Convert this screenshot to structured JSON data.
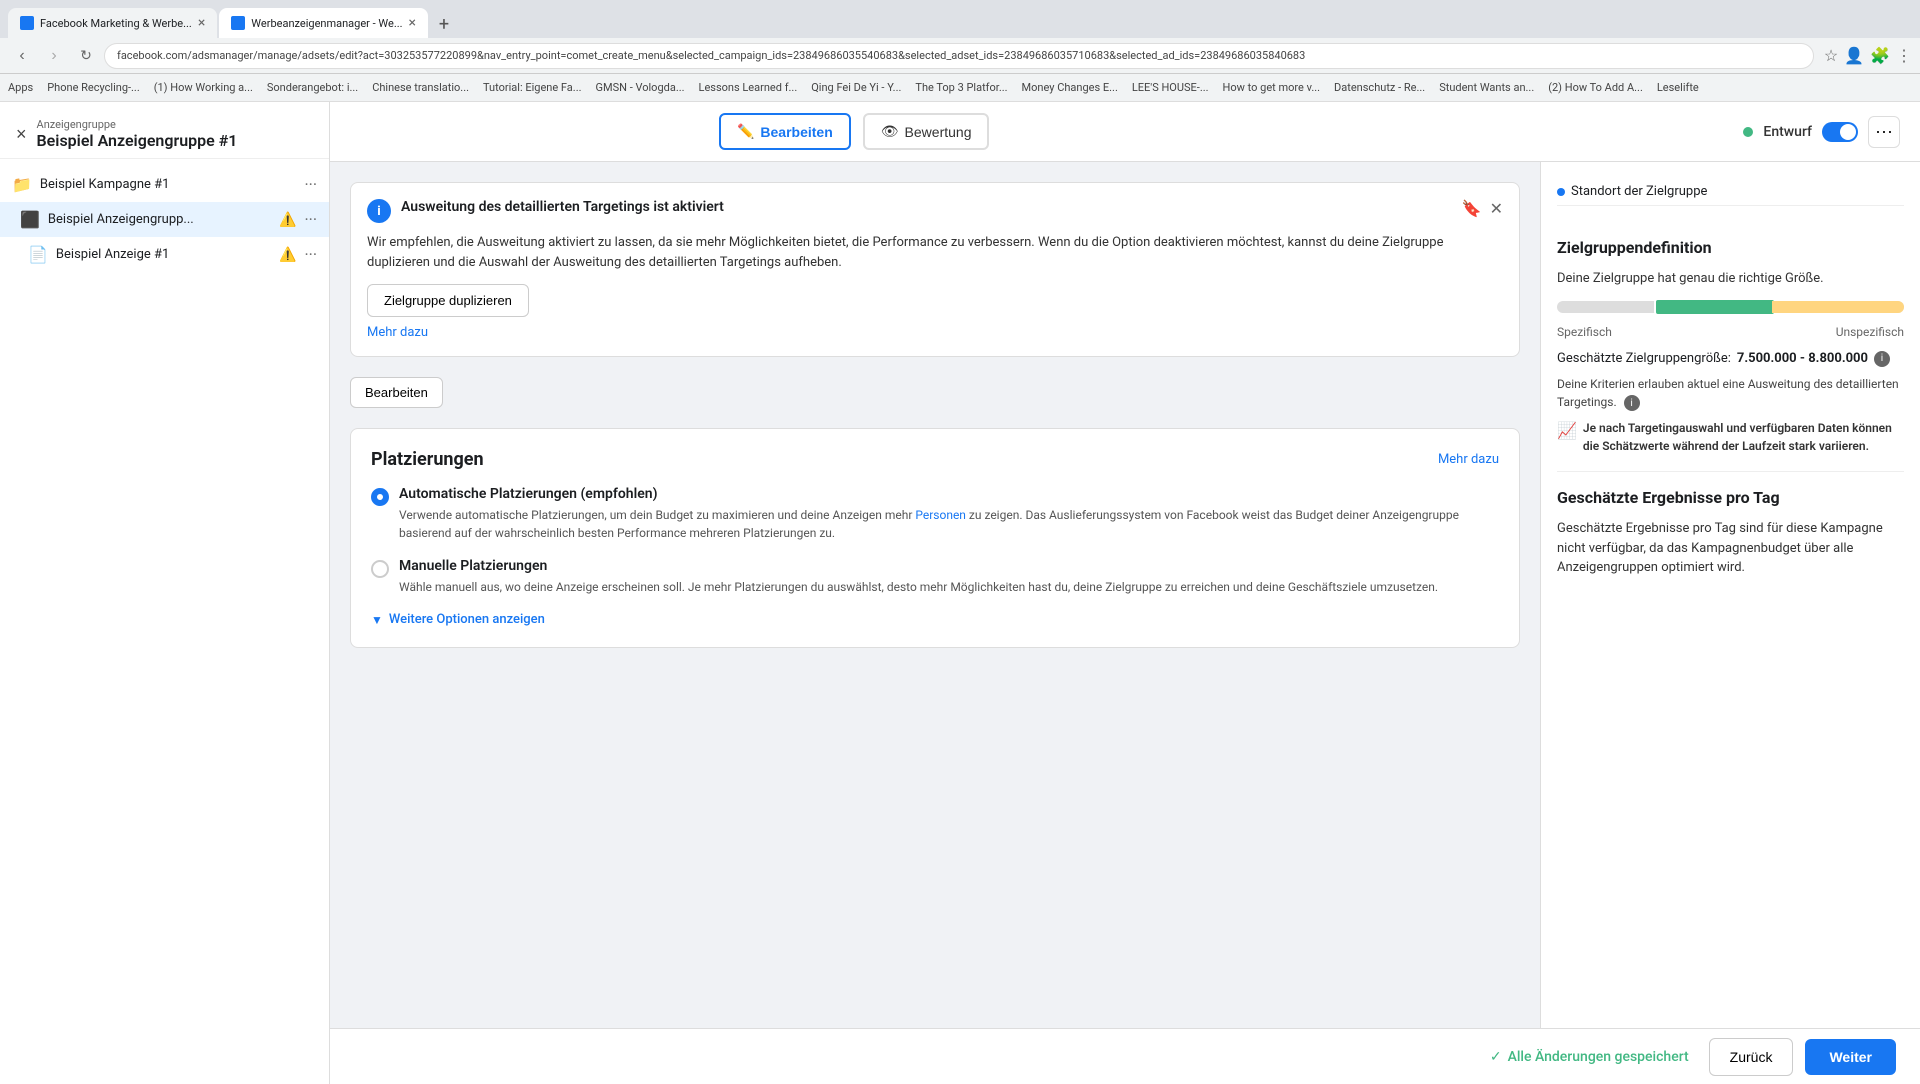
{
  "browser": {
    "tabs": [
      {
        "id": "tab1",
        "title": "Facebook Marketing & Werbe...",
        "active": false
      },
      {
        "id": "tab2",
        "title": "Werbeanzeigenmanager - We...",
        "active": true
      }
    ],
    "url": "facebook.com/adsmanager/manage/adsets/edit?act=303253577220899&nav_entry_point=comet_create_menu&selected_campaign_ids=23849686035540683&selected_adset_ids=23849686035710683&selected_ad_ids=23849686035840683",
    "bookmarks": [
      "Apps",
      "Phone Recycling-...",
      "(1) How Working a...",
      "Sonderangebot: i...",
      "Chinese translatio...",
      "Tutorial: Eigene Fa...",
      "GMSN - Vologda...",
      "Lessons Learned f...",
      "Qing Fei De Yi - Y...",
      "The Top 3 Platfor...",
      "Money Changes E...",
      "LEE'S HOUSE-...",
      "How to get more v...",
      "Datenschutz - Re...",
      "Student Wants an...",
      "(2) How To Add A...",
      "Leselifte"
    ]
  },
  "app": {
    "header": {
      "subtitle": "Anzeigengruppe",
      "title": "Beispiel Anzeigengruppe #1",
      "edit_label": "Bearbeiten",
      "preview_label": "Bewertung",
      "status_label": "Entwurf",
      "more_label": "..."
    },
    "sidebar": {
      "close_btn": "×",
      "items": [
        {
          "type": "campaign",
          "icon": "📁",
          "label": "Beispiel Kampagne #1",
          "warning": false
        },
        {
          "type": "adset",
          "icon": "⬛",
          "label": "Beispiel Anzeigengrupp...",
          "warning": true
        },
        {
          "type": "ad",
          "icon": "📄",
          "label": "Beispiel Anzeige #1",
          "warning": true
        }
      ]
    },
    "info_box": {
      "title": "Ausweitung des detaillierten Targetings ist aktiviert",
      "body": "Wir empfehlen, die Ausweitung aktiviert zu lassen, da sie mehr Möglichkeiten bietet, die Performance zu verbessern. Wenn du die Option deaktivieren möchtest, kannst du deine Zielgruppe duplizieren und die Auswahl der Ausweitung des detaillierten Targetings aufheben.",
      "duplicate_btn": "Zielgruppe duplizieren",
      "more_link": "Mehr dazu"
    },
    "edit_btn": "Bearbeiten",
    "placements": {
      "title": "Platzierungen",
      "more_link": "Mehr dazu",
      "auto_title": "Automatische Platzierungen (empfohlen)",
      "auto_desc_1": "Verwende automatische Platzierungen, um dein Budget zu maximieren und deine Anzeigen mehr ",
      "auto_link": "Personen",
      "auto_desc_2": " zu zeigen. Das Auslieferungssystem von Facebook weist das Budget deiner Anzeigengruppe basierend auf der wahrscheinlich besten Performance mehreren Platzierungen zu.",
      "manual_title": "Manuelle Platzierungen",
      "manual_desc": "Wähle manuell aus, wo deine Anzeige erscheinen soll. Je mehr Platzierungen du auswählst, desto mehr Möglichkeiten hast du, deine Zielgruppe zu erreichen und deine Geschäftsziele umzusetzen.",
      "more_options": "Weitere Optionen anzeigen"
    },
    "right_panel": {
      "location_label": "Standort der Zielgruppe",
      "audience_def_title": "Zielgruppendefinition",
      "audience_desc": "Deine Zielgruppe hat genau die richtige Größe.",
      "specific_label": "Spezifisch",
      "unspecific_label": "Unspezifisch",
      "size_label": "Geschätzte Zielgruppengröße:",
      "size_value": "7.500.000 - 8.800.000",
      "expansion_note": "Deine Kriterien erlauben aktuel eine Ausweitung des detaillierten Targetings.",
      "variation_note": "Je nach Targetingauswahl und verfügbaren Daten können die Schätzwerte während der Laufzeit stark variieren.",
      "daily_results_title": "Geschätzte Ergebnisse pro Tag",
      "daily_results_desc": "Geschätzte Ergebnisse pro Tag sind für diese Kampagne nicht verfügbar, da das Kampagnenbudget über alle Anzeigengruppen optimiert wird."
    },
    "footer": {
      "saved_label": "Alle Änderungen gespeichert",
      "back_label": "Zurück",
      "next_label": "Weiter"
    }
  }
}
